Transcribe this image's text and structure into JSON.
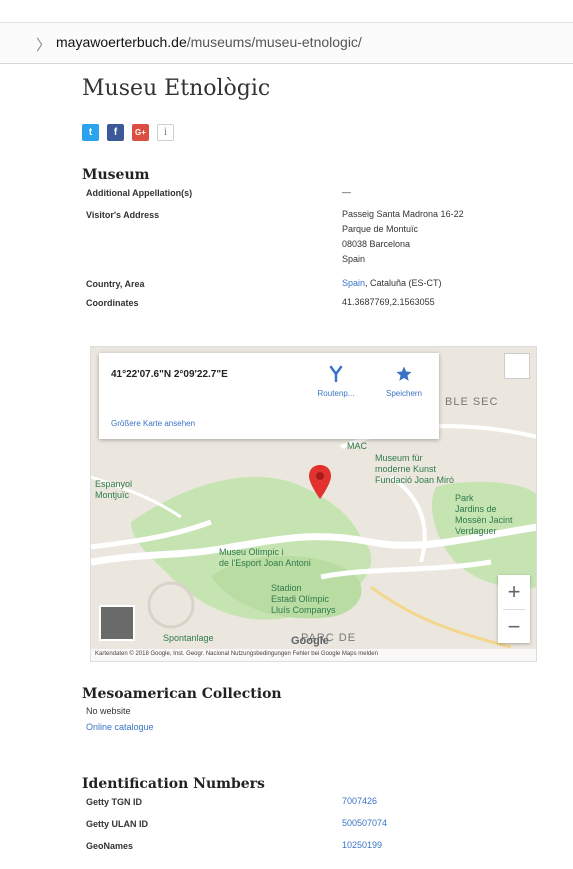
{
  "browser": {
    "url_domain": "mayawoerterbuch.de",
    "url_path": "/museums/museu-etnologic/",
    "chevron": "〉"
  },
  "page": {
    "title": "Museu Etnològic"
  },
  "share": {
    "twitter_glyph": "t",
    "facebook_glyph": "f",
    "googleplus_glyph": "G+",
    "info_glyph": "i"
  },
  "museum": {
    "heading": "Museum",
    "rows": [
      {
        "label": "Additional Appellation(s)",
        "value": "—"
      },
      {
        "label": "Visitor's Address",
        "lines": [
          "Passeig Santa Madrona 16-22",
          "Parque de Montuïc",
          "08038 Barcelona",
          "Spain"
        ]
      },
      {
        "label": "Country, Area",
        "link": "Spain",
        "value": ", Cataluña (ES-CT)"
      },
      {
        "label": "Coordinates",
        "value": "41.3687769,2.1563055"
      }
    ]
  },
  "map": {
    "coordinates": "41°22'07.6\"N 2°09'22.7\"E",
    "route_label": "Routenp...",
    "save_label": "Speichern",
    "enlarge_label": "Größere Karte ansehen",
    "zoom_in": "+",
    "zoom_out": "−",
    "google_logo": "Google",
    "footer": "Kartendaten © 2018 Google, Inst. Geogr. Nacional   Nutzungsbedingungen   Fehler bei Google Maps melden",
    "labels": {
      "mac": "MAC",
      "museum_modern": "Museum für\nmoderne Kunst\nFundació Joan Miró",
      "espanyol": "Espanyol\nMontjuïc",
      "park": "Park\nJardins de\nMossèn Jacint\nVerdaguer",
      "olimpic": "Museu Olímpic i\nde l'Esport Joan Antoni",
      "stadion": "Stadion\nEstadi Olímpic\nLluís Companys",
      "spontanlage": "Spontanlage",
      "parc_de": "PARC DE",
      "ble_sec": "BLE SEC"
    }
  },
  "collection": {
    "heading": "Mesoamerican Collection",
    "website": "No website",
    "catalogue": "Online catalogue"
  },
  "identification": {
    "heading": "Identification Numbers",
    "rows": [
      {
        "label": "Getty TGN ID",
        "value": "7007426"
      },
      {
        "label": "Getty ULAN ID",
        "value": "500507074"
      },
      {
        "label": "GeoNames",
        "value": "10250199"
      }
    ]
  },
  "colors": {
    "link": "#3a73c6",
    "twitter": "#2aa3ef",
    "facebook": "#3b5998",
    "googleplus": "#dc4e41",
    "map_pin": "#e1322e",
    "park_green": "#c6e3b2"
  }
}
